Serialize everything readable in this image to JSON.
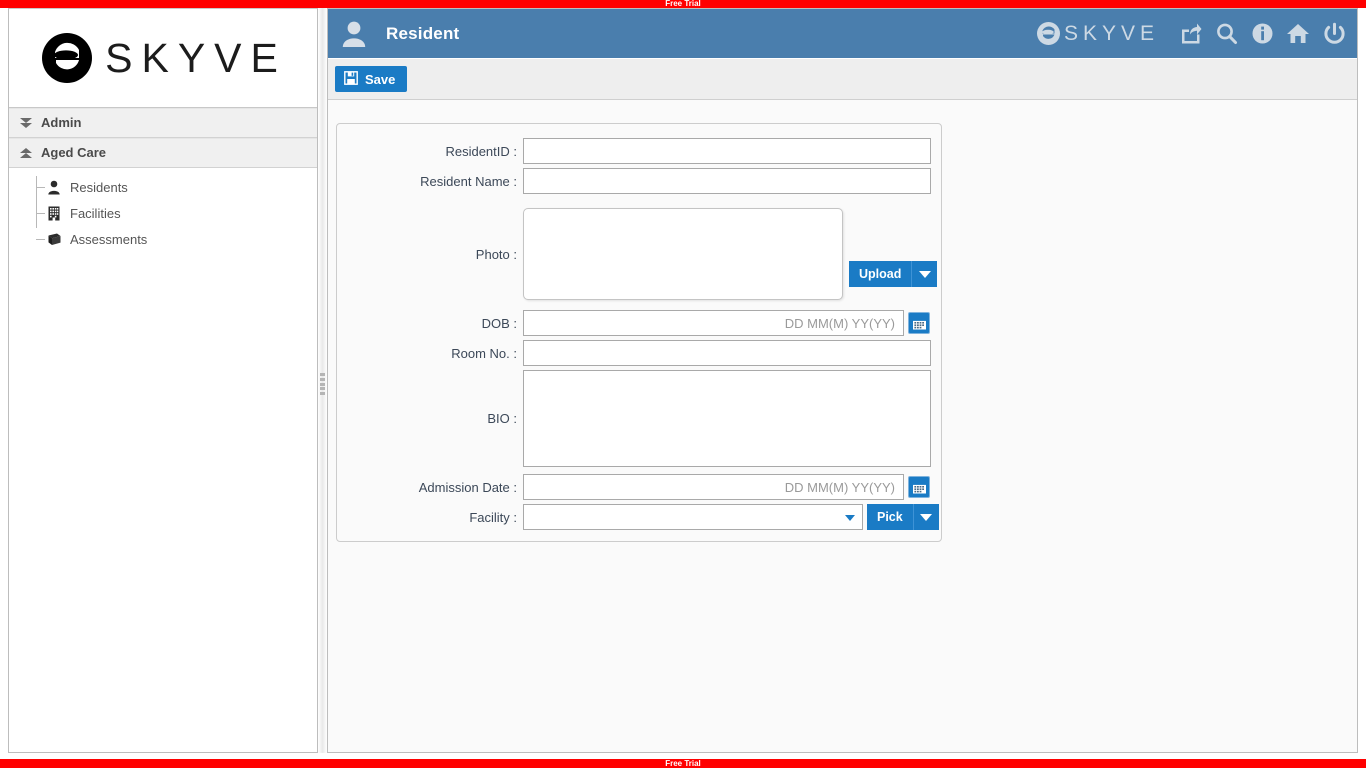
{
  "trial": {
    "top_label": "Free Trial",
    "bottom_label": "Free Trial"
  },
  "brand": {
    "name": "SKYVE",
    "header_name": "SKYVE"
  },
  "sidebar": {
    "groups": [
      {
        "label": "Admin",
        "icon": "chevron-double-down-icon",
        "expanded": false
      },
      {
        "label": "Aged Care",
        "icon": "chevron-double-up-icon",
        "expanded": true
      }
    ],
    "items": [
      {
        "label": "Residents",
        "icon": "person-icon"
      },
      {
        "label": "Facilities",
        "icon": "building-icon"
      },
      {
        "label": "Assessments",
        "icon": "book-icon"
      }
    ]
  },
  "header": {
    "title": "Resident",
    "title_icon": "person-icon",
    "icons": [
      {
        "name": "share-export-icon"
      },
      {
        "name": "search-icon"
      },
      {
        "name": "info-icon"
      },
      {
        "name": "home-icon"
      },
      {
        "name": "power-icon"
      }
    ]
  },
  "toolbar": {
    "save_label": "Save",
    "save_icon": "floppy-disk-icon"
  },
  "form": {
    "fields": [
      {
        "label": "ResidentID :",
        "type": "text",
        "value": "",
        "placeholder": ""
      },
      {
        "label": "Resident Name :",
        "type": "text",
        "value": "",
        "placeholder": ""
      },
      {
        "label": "Photo :",
        "type": "image",
        "value": ""
      },
      {
        "label": "DOB :",
        "type": "date",
        "value": "",
        "placeholder": "DD MM(M) YY(YY)"
      },
      {
        "label": "Room No. :",
        "type": "text",
        "value": "",
        "placeholder": ""
      },
      {
        "label": "BIO :",
        "type": "textarea",
        "value": "",
        "placeholder": ""
      },
      {
        "label": "Admission Date :",
        "type": "date",
        "value": "",
        "placeholder": "DD MM(M) YY(YY)"
      },
      {
        "label": "Facility :",
        "type": "lookup",
        "value": "",
        "placeholder": ""
      }
    ],
    "upload_label": "Upload",
    "pick_label": "Pick"
  },
  "colors": {
    "trial_red": "#ff0000",
    "title_blue": "#4a7ead",
    "button_blue": "#1a7bc5",
    "panel_grey": "#eeeeee",
    "card_bg": "#fafafa"
  }
}
